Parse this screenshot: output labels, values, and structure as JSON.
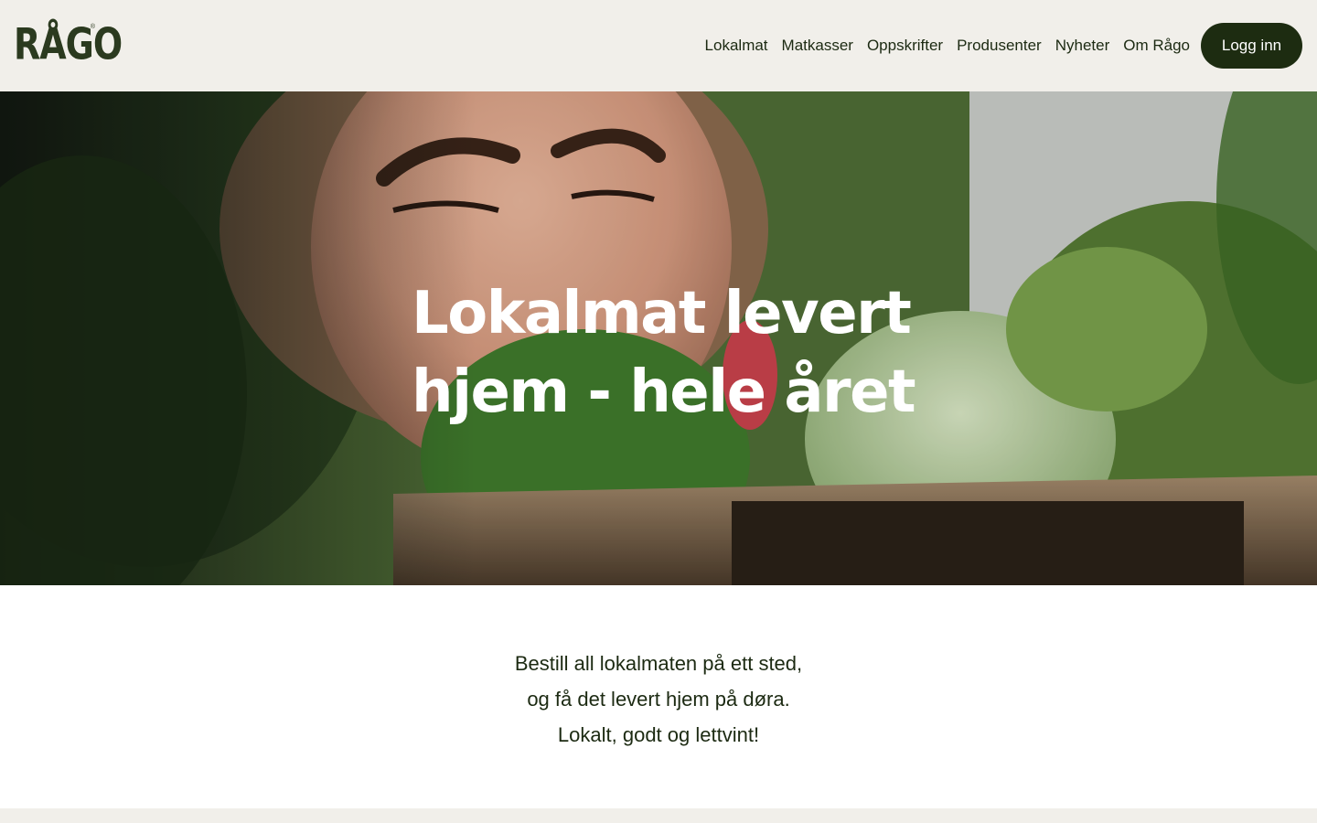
{
  "brand": {
    "logo_text": "RÅGO",
    "registered_mark": "®"
  },
  "nav": {
    "items": [
      {
        "label": "Lokalmat"
      },
      {
        "label": "Matkasser"
      },
      {
        "label": "Oppskrifter"
      },
      {
        "label": "Produsenter"
      },
      {
        "label": "Nyheter"
      },
      {
        "label": "Om Rågo"
      }
    ],
    "login_label": "Logg inn"
  },
  "hero": {
    "headline_line1": "Lokalmat levert",
    "headline_line2": "hjem - hele året"
  },
  "intro": {
    "line1": "Bestill all lokalmaten på ett sted,",
    "line2": "og få det levert hjem på døra.",
    "line3": "Lokalt, godt og lettvint!"
  },
  "colors": {
    "header_bg": "#f1efea",
    "brand_dark": "#1d2c11",
    "text": "#1c2a12"
  }
}
